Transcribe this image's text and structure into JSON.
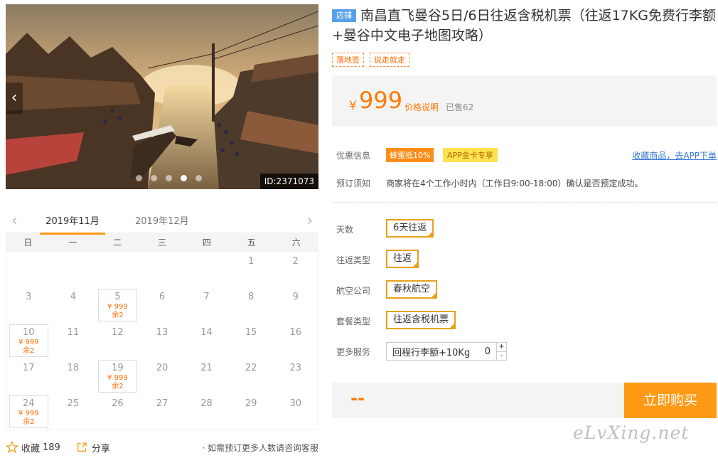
{
  "photo": {
    "id_label": "ID:2371073",
    "prev": "‹",
    "next": "›"
  },
  "calendar": {
    "prev": "‹",
    "next": "›",
    "months": [
      "2019年11月",
      "2019年12月"
    ],
    "weekdays": [
      "日",
      "一",
      "二",
      "三",
      "四",
      "五",
      "六"
    ],
    "leading_blanks": 5,
    "days": [
      {
        "d": "1"
      },
      {
        "d": "2"
      },
      {
        "d": "3"
      },
      {
        "d": "4"
      },
      {
        "d": "5",
        "price": "¥ 999",
        "left": "余2"
      },
      {
        "d": "6"
      },
      {
        "d": "7"
      },
      {
        "d": "8"
      },
      {
        "d": "9"
      },
      {
        "d": "10",
        "price": "¥ 999",
        "left": "余2"
      },
      {
        "d": "11"
      },
      {
        "d": "12"
      },
      {
        "d": "13"
      },
      {
        "d": "14"
      },
      {
        "d": "15"
      },
      {
        "d": "16"
      },
      {
        "d": "17"
      },
      {
        "d": "18"
      },
      {
        "d": "19",
        "price": "¥ 999",
        "left": "余2"
      },
      {
        "d": "20"
      },
      {
        "d": "21"
      },
      {
        "d": "22"
      },
      {
        "d": "23"
      },
      {
        "d": "24",
        "price": "¥ 999",
        "left": "余2"
      },
      {
        "d": "25"
      },
      {
        "d": "26"
      },
      {
        "d": "27"
      },
      {
        "d": "28"
      },
      {
        "d": "29"
      },
      {
        "d": "30"
      }
    ]
  },
  "footer": {
    "fav_label": "收藏",
    "fav_count": "189",
    "share_label": "分享",
    "consult": "· 如需预订更多人数请咨询客服"
  },
  "product": {
    "shop_tag": "店铺",
    "title": "南昌直飞曼谷5日/6日往返含税机票（往返17KG免费行李额+曼谷中文电子地图攻略）",
    "tags": [
      "落地签",
      "说走就走"
    ],
    "price_symbol": "¥",
    "price": "999",
    "price_note": "价格说明",
    "sold": "已售62"
  },
  "promo": {
    "label": "优惠信息",
    "badge1": "蜂蜜抵10%",
    "badge2": "APP金卡专享",
    "fav_link": "收藏商品，去APP下单"
  },
  "notice": {
    "label": "预订须知",
    "text": "商家将在4个工作小时内（工作日9:00-18:00）确认是否预定成功。"
  },
  "options": {
    "days_label": "天数",
    "days_value": "6天往返",
    "trip_label": "往返类型",
    "trip_value": "往返",
    "airline_label": "航空公司",
    "airline_value": "春秋航空",
    "package_label": "套餐类型",
    "package_value": "往返含税机票",
    "service_label": "更多服务",
    "service_value": "回程行李额+10Kg",
    "service_qty": "0",
    "plus": "+",
    "minus": "-"
  },
  "buy": {
    "total": "--",
    "button": "立即购买"
  },
  "watermark": "eLvXing.net",
  "colors": {
    "accent": "#ff9a14",
    "price": "#ff7a00",
    "link": "#3579d8"
  }
}
